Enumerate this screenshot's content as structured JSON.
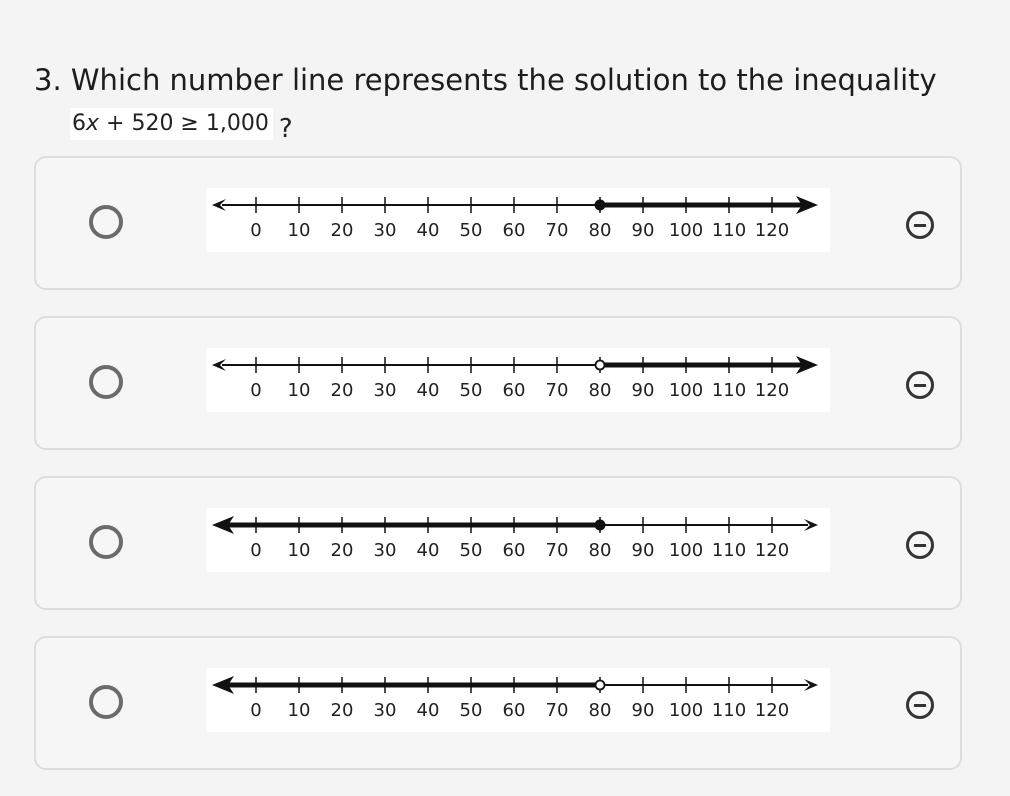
{
  "question": {
    "text": "3. Which number line represents the solution to the inequality",
    "formula_prefix": "6",
    "formula_var": "x",
    "formula_rest": " + 520 ≥ 1,000",
    "question_mark": "?"
  },
  "number_line_ticks": [
    "0",
    "10",
    "20",
    "30",
    "40",
    "50",
    "60",
    "70",
    "80",
    "90",
    "100",
    "110",
    "120"
  ],
  "options": [
    {
      "endpoint_value": 80,
      "endpoint": "closed",
      "shaded_direction": "right"
    },
    {
      "endpoint_value": 80,
      "endpoint": "open",
      "shaded_direction": "right"
    },
    {
      "endpoint_value": 80,
      "endpoint": "closed",
      "shaded_direction": "left"
    },
    {
      "endpoint_value": 80,
      "endpoint": "open",
      "shaded_direction": "left"
    }
  ],
  "icons": {
    "radio": "radio-circle-icon",
    "eliminate": "eliminate-choice-icon"
  },
  "colors": {
    "background": "#f4f4f4",
    "card_border": "#dddddd",
    "radio": "#6b6b6b",
    "line": "#111111"
  }
}
